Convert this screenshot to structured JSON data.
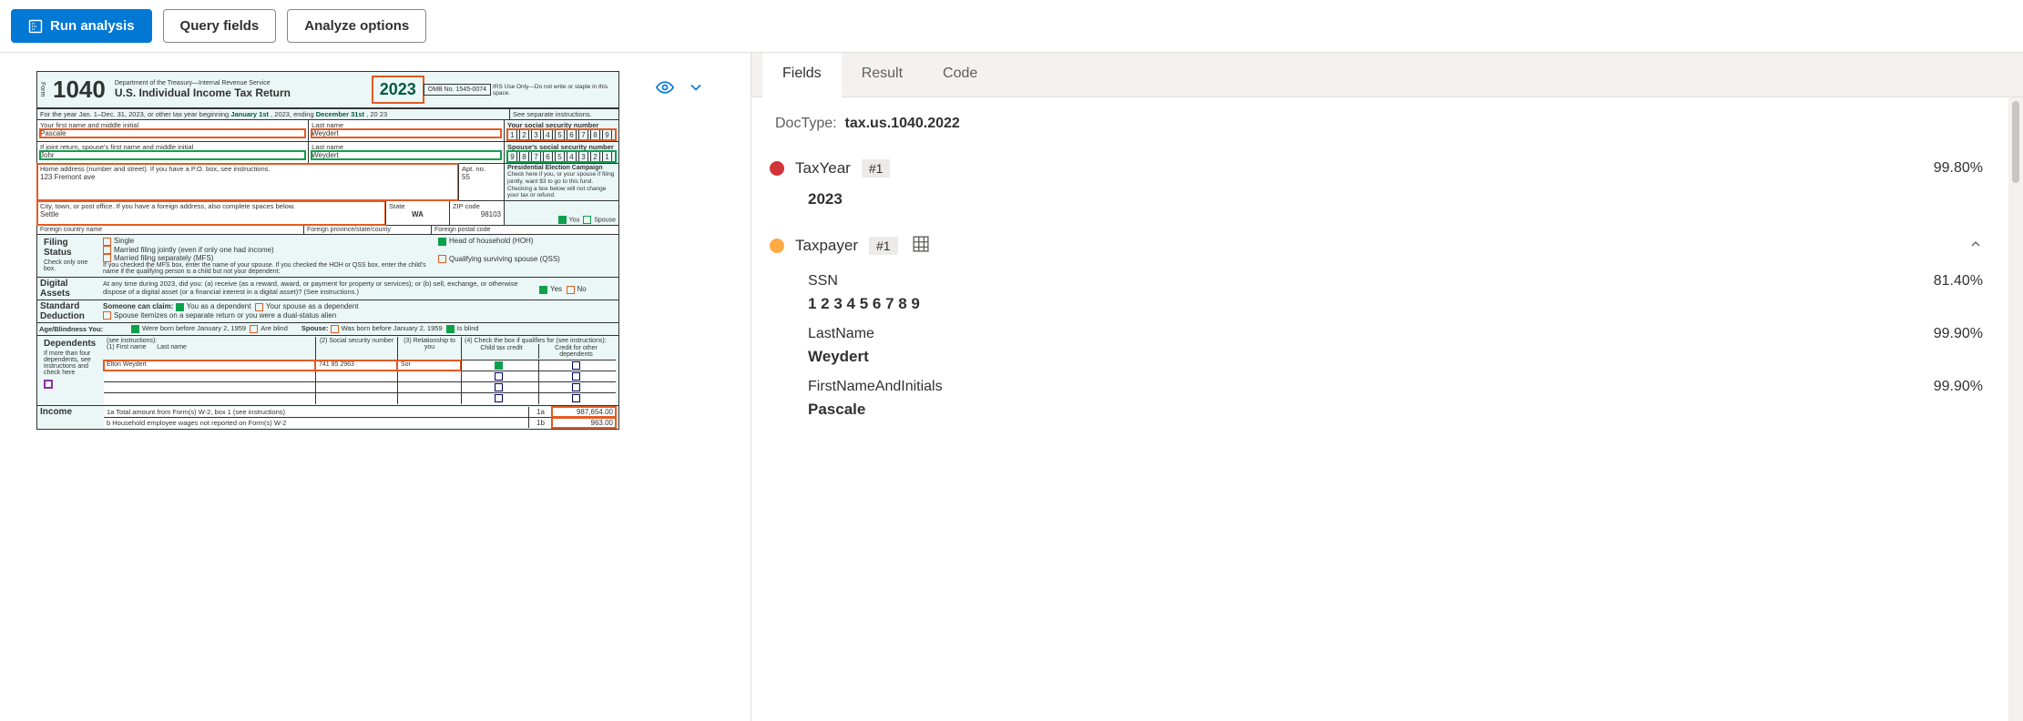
{
  "toolbar": {
    "run_label": "Run analysis",
    "query_label": "Query fields",
    "analyze_label": "Analyze options"
  },
  "tabs": {
    "fields": "Fields",
    "result": "Result",
    "code": "Code"
  },
  "docType": {
    "label": "DocType:",
    "value": "tax.us.1040.2022"
  },
  "results": [
    {
      "color": "red",
      "name": "TaxYear",
      "badge": "#1",
      "confidence": "99.80%",
      "value": "2023",
      "expandable": false
    },
    {
      "color": "orange",
      "name": "Taxpayer",
      "badge": "#1",
      "confidence": "",
      "expandable": true,
      "subfields": [
        {
          "name": "SSN",
          "confidence": "81.40%",
          "value": "1 2 3 4 5 6 7 8 9"
        },
        {
          "name": "LastName",
          "confidence": "99.90%",
          "value": "Weydert"
        },
        {
          "name": "FirstNameAndInitials",
          "confidence": "99.90%",
          "value": "Pascale"
        }
      ]
    }
  ],
  "form": {
    "formNo": "1040",
    "dept": "Department of the Treasury—Internal Revenue Service",
    "title": "U.S. Individual Income Tax Return",
    "year": "2023",
    "omb": "OMB No. 1545-0074",
    "irsOnly": "IRS Use Only—Do not write or staple in this space.",
    "periodLabel": "For the year Jan. 1–Dec. 31, 2023, or other tax year beginning",
    "periodBegin": "January 1st",
    "periodMid": ", 2023, ending",
    "periodEnd": "December 31st",
    "periodYY": ", 20 23",
    "seeInstr": "See separate instructions.",
    "labels": {
      "firstName": "Your first name and middle initial",
      "lastName": "Last name",
      "ssn": "Your social security number",
      "spFirst": "If joint return, spouse's first name and middle initial",
      "spLast": "Last name",
      "spSsn": "Spouse's social security number",
      "addr": "Home address (number and street). If you have a P.O. box, see instructions.",
      "apt": "Apt. no.",
      "city": "City, town, or post office. If you have a foreign address, also complete spaces below.",
      "state": "State",
      "zip": "ZIP code",
      "fCountry": "Foreign country name",
      "fProv": "Foreign province/state/county",
      "fPostal": "Foreign postal code",
      "pec": "Presidential Election Campaign",
      "pecText": "Check here if you, or your spouse if filing jointly, want $3 to go to this fund. Checking a box below will not change your tax or refund.",
      "you": "You",
      "spouse": "Spouse"
    },
    "values": {
      "firstName": "Pascale",
      "lastName": "Weydert",
      "ssn": [
        "1",
        "2",
        "3",
        "4",
        "5",
        "6",
        "7",
        "8",
        "9"
      ],
      "spFirst": "Johr",
      "spLast": "Weydert",
      "spSsn": [
        "9",
        "8",
        "7",
        "6",
        "5",
        "4",
        "3",
        "2",
        "1"
      ],
      "addr": "123 Fremont ave",
      "apt": "55",
      "city": "Settle",
      "state": "WA",
      "zip": "98103"
    },
    "filing": {
      "title": "Filing Status",
      "hint": "Check only one box.",
      "single": "Single",
      "mfj": "Married filing jointly (even if only one had income)",
      "mfs": "Married filing separately (MFS)",
      "hoh": "Head of household (HOH)",
      "qss": "Qualifying surviving spouse (QSS)",
      "note": "If you checked the MFS box, enter the name of your spouse. If you checked the HOH or QSS box, enter the child's name if the qualifying person is a child but not your dependent:"
    },
    "digital": {
      "title": "Digital Assets",
      "text": "At any time during 2023, did you: (a) receive (as a reward, award, or payment for property or services); or (b) sell, exchange, or otherwise dispose of a digital asset (or a financial interest in a digital asset)? (See instructions.)",
      "yes": "Yes",
      "no": "No"
    },
    "stdded": {
      "title": "Standard Deduction",
      "someone": "Someone can claim:",
      "youDep": "You as a dependent",
      "spDep": "Your spouse as a dependent",
      "itemize": "Spouse itemizes on a separate return or you were a dual-status alien"
    },
    "ageblind": {
      "youLbl": "Age/Blindness  You:",
      "born": "Were born before January 2, 1959",
      "blind": "Are blind",
      "spLbl": "Spouse:",
      "spBorn": "Was born before January 2, 1959",
      "spBlind": "Is blind"
    },
    "deps": {
      "title": "Dependents",
      "see": "(see instructions):",
      "c1": "(1) First name",
      "c1b": "Last name",
      "c2": "(2) Social security number",
      "c3": "(3) Relationship to you",
      "c4": "(4) Check the box if qualifies for (see instructions):",
      "c4a": "Child tax credit",
      "c4b": "Credit for other dependents",
      "more": "If more than four dependents, see instructions and check here",
      "name": "Elton Weydert",
      "ssn": "741  85   2963",
      "rel": "Sor"
    },
    "income": {
      "title": "Income",
      "l1a": "1a   Total amount from Form(s) W-2, box 1 (see instructions)",
      "l1a_no": "1a",
      "l1a_val": "987,654.00",
      "l1b": "b    Household employee wages not reported on Form(s) W-2",
      "l1b_no": "1b",
      "l1b_val": "963.00"
    }
  }
}
